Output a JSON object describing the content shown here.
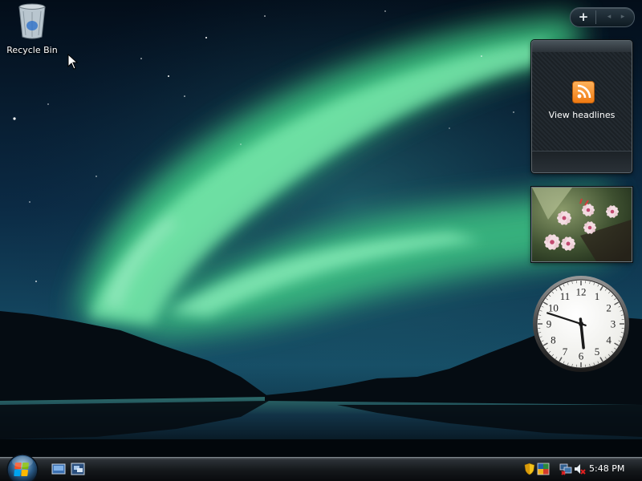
{
  "desktop": {
    "icons": [
      {
        "label": "Recycle Bin",
        "icon": "recycle-bin-icon"
      }
    ]
  },
  "sidebar": {
    "controls": {
      "add_label": "+",
      "prev_label": "◂",
      "next_label": "▸"
    },
    "gadgets": {
      "feed_headlines": {
        "text": "View headlines",
        "icon": "rss-feed-icon",
        "icon_color": "#F5871F"
      },
      "slideshow": {
        "content": "pink-frangipani-flowers"
      },
      "clock": {
        "numerals": [
          "12",
          "1",
          "2",
          "3",
          "4",
          "5",
          "6",
          "7",
          "8",
          "9",
          "10",
          "11"
        ],
        "time": "5:48 PM"
      }
    }
  },
  "taskbar": {
    "start_button": "windows-logo-icon",
    "quick_launch": [
      "show-desktop-icon",
      "switch-windows-icon"
    ],
    "tray_icons": [
      "security-shield-icon",
      "network-icon",
      "network-disconnected-icon",
      "volume-muted-icon"
    ],
    "clock": "5:48 PM"
  },
  "colors": {
    "aurora": "#49D98A",
    "sky_dark": "#071828",
    "taskbar": "#15191C"
  }
}
